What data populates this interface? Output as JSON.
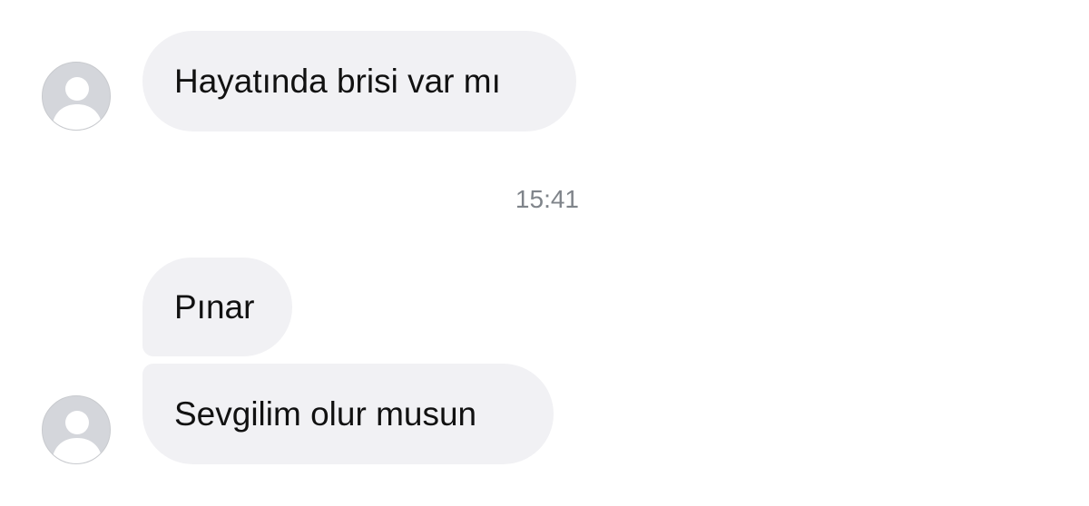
{
  "conversation": {
    "messages": [
      {
        "text": "Hayatında brisi var mı"
      },
      {
        "text": "Pınar"
      },
      {
        "text": "Sevgilim olur musun"
      }
    ],
    "timestamp": "15:41",
    "avatar_icon": "default-user-avatar-icon"
  },
  "colors": {
    "background": "#ffffff",
    "bubble": "#f1f1f4",
    "text": "#111111",
    "timestamp": "#7f848a",
    "avatar_bg": "#d4d6db",
    "avatar_silhouette": "#ffffff"
  }
}
